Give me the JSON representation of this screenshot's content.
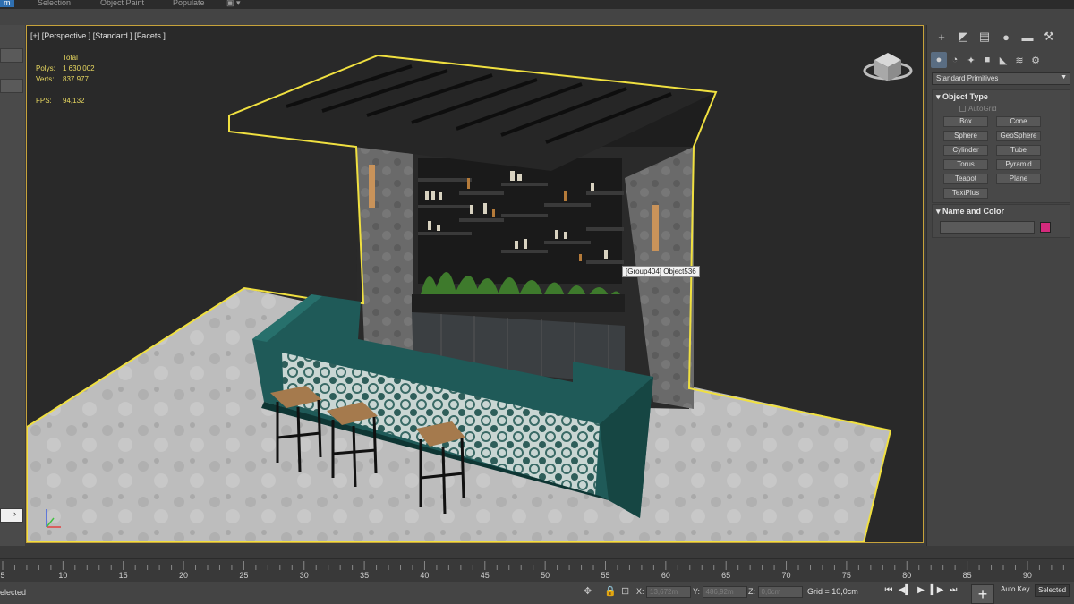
{
  "top_tabs": [
    "m",
    "Selection",
    "Object Paint",
    "Populate"
  ],
  "viewport": {
    "label": "[+] [Perspective ] [Standard ] [Facets ]",
    "stats": {
      "header": "Total",
      "polys_label": "Polys:",
      "polys_value": "1 630 002",
      "verts_label": "Verts:",
      "verts_value": "837 977",
      "fps_label": "FPS:",
      "fps_value": "94,132"
    },
    "tooltip": "[Group404] Object536"
  },
  "command_panel": {
    "category_dropdown": "Standard Primitives",
    "object_type": {
      "title": "Object Type",
      "autogrid": "AutoGrid",
      "buttons": [
        "Box",
        "Cone",
        "Sphere",
        "GeoSphere",
        "Cylinder",
        "Tube",
        "Torus",
        "Pyramid",
        "Teapot",
        "Plane",
        "TextPlus"
      ]
    },
    "name_and_color": {
      "title": "Name and Color",
      "name_value": "",
      "color": "#d42a7c"
    }
  },
  "timeline": {
    "ticks": [
      "5",
      "10",
      "15",
      "20",
      "25",
      "30",
      "35",
      "40",
      "45",
      "50",
      "55",
      "60",
      "65",
      "70",
      "75",
      "80",
      "85",
      "90"
    ]
  },
  "statusbar": {
    "selection_text": "elected",
    "x_label": "X:",
    "x_value": "13,672m",
    "y_label": "Y:",
    "y_value": "486,92m",
    "z_label": "Z:",
    "z_value": "0,0cm",
    "grid_text": "Grid = 10,0cm",
    "auto_key": "Auto Key",
    "selected": "Selected"
  }
}
